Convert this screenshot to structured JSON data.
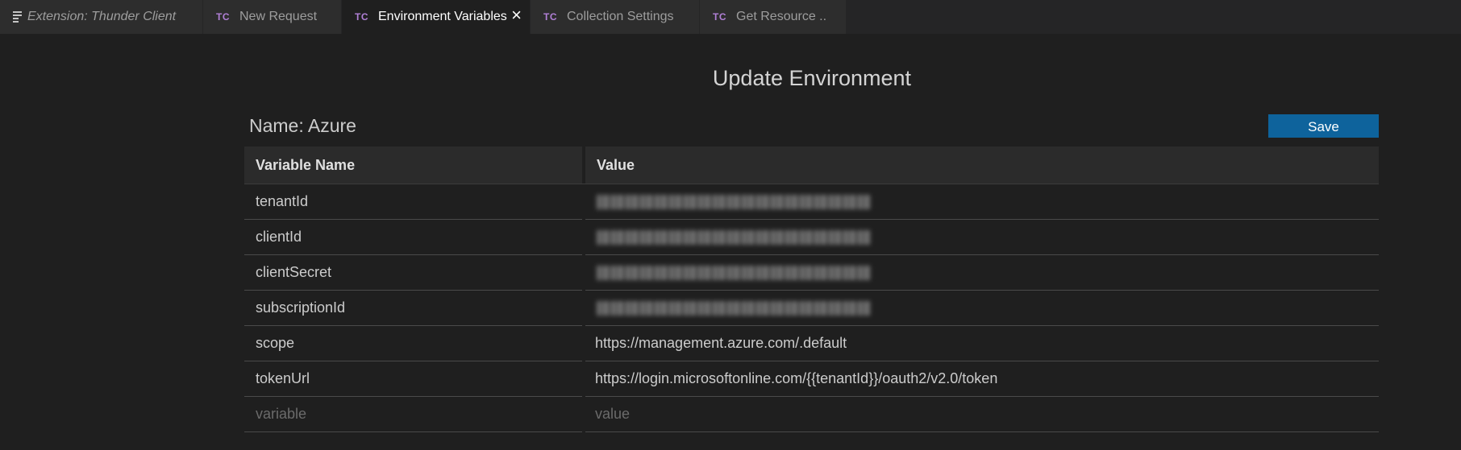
{
  "tabs": [
    {
      "label": "Extension: Thunder Client",
      "icon": "menu-icon",
      "active": false
    },
    {
      "label": "New Request",
      "prefix": "TC",
      "active": false
    },
    {
      "label": "Environment Variables",
      "prefix": "TC",
      "active": true
    },
    {
      "label": "Collection Settings",
      "prefix": "TC",
      "active": false
    },
    {
      "label": "Get Resource ..",
      "prefix": "TC",
      "active": false
    }
  ],
  "panel": {
    "title": "Update Environment",
    "name_label": "Name: Azure",
    "save_label": "Save"
  },
  "table": {
    "headers": {
      "name": "Variable Name",
      "value": "Value"
    },
    "rows": [
      {
        "name": "tenantId",
        "value": "",
        "redacted": true
      },
      {
        "name": "clientId",
        "value": "",
        "redacted": true
      },
      {
        "name": "clientSecret",
        "value": "",
        "redacted": true
      },
      {
        "name": "subscriptionId",
        "value": "",
        "redacted": true
      },
      {
        "name": "scope",
        "value": "https://management.azure.com/.default",
        "redacted": false
      },
      {
        "name": "tokenUrl",
        "value": "https://login.microsoftonline.com/{{tenantId}}/oauth2/v2.0/token",
        "redacted": false
      }
    ],
    "new_row": {
      "name_placeholder": "variable",
      "value_placeholder": "value"
    }
  },
  "colors": {
    "accent_button": "#0e639c",
    "tc_badge": "#b180d7",
    "background": "#1f1f1f"
  }
}
